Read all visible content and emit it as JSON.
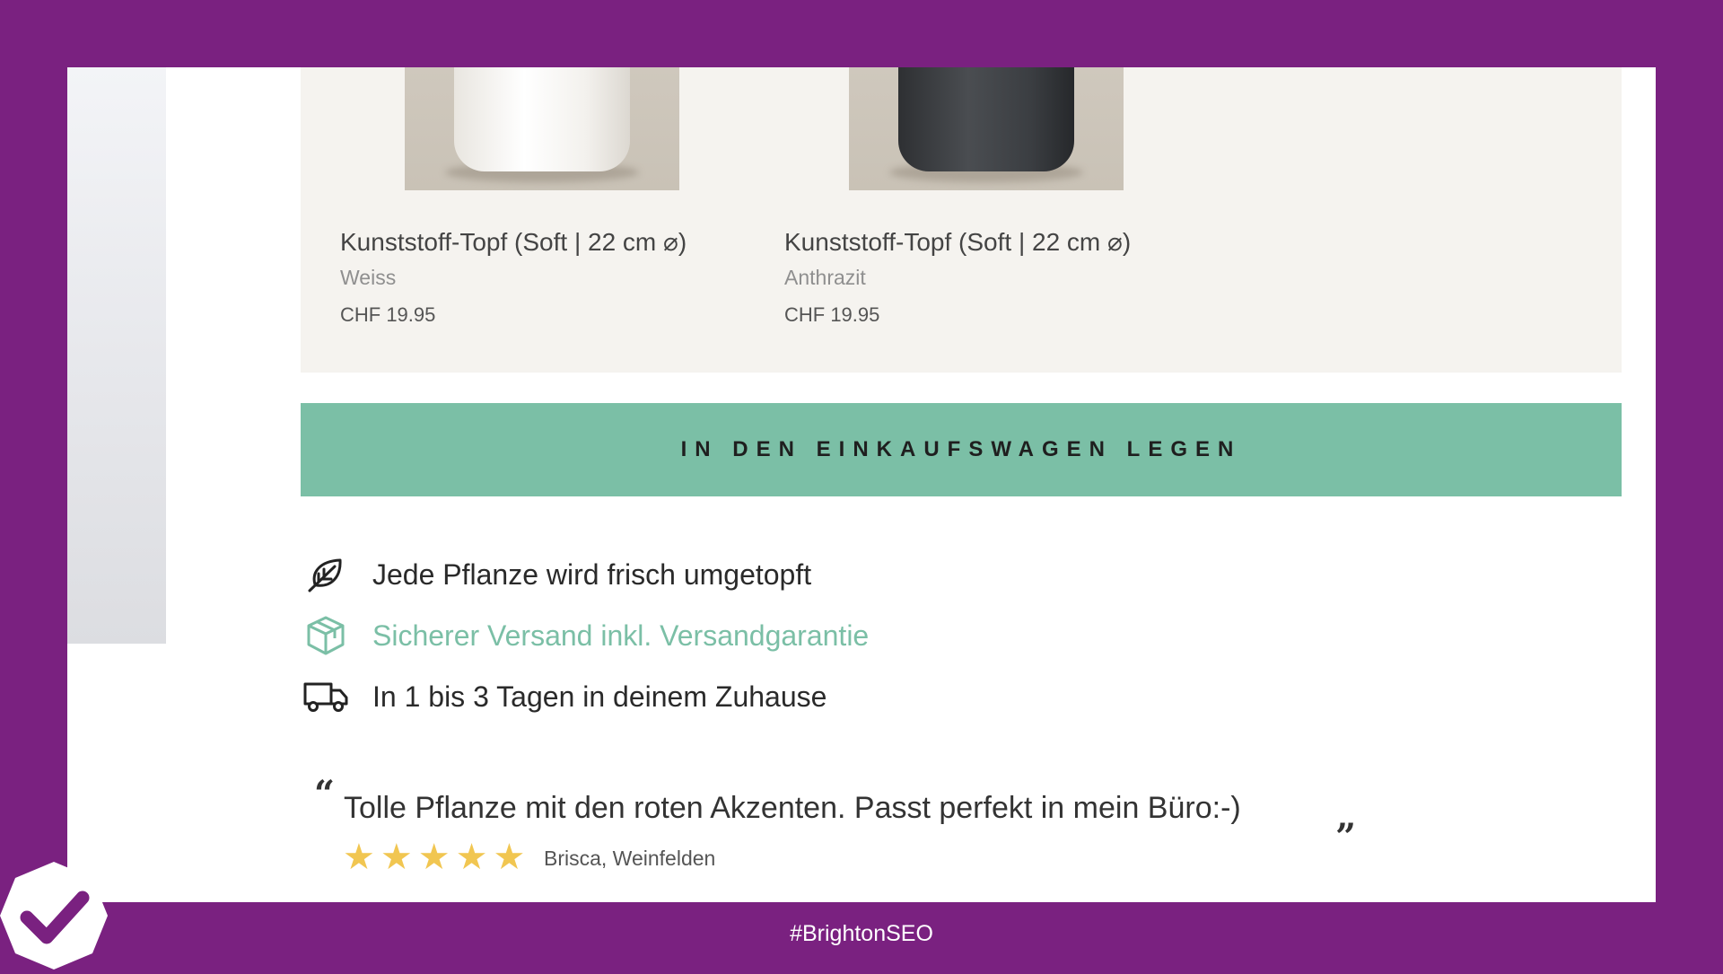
{
  "products": [
    {
      "title": "Kunststoff-Topf (Soft | 22 cm ⌀)",
      "variant": "Weiss",
      "price": "CHF 19.95"
    },
    {
      "title": "Kunststoff-Topf (Soft | 22 cm ⌀)",
      "variant": "Anthrazit",
      "price": "CHF 19.95"
    }
  ],
  "cart_button": {
    "label": "IN DEN EINKAUFSWAGEN LEGEN"
  },
  "features": [
    {
      "icon": "leaf-icon",
      "text": "Jede Pflanze wird frisch umgetopft"
    },
    {
      "icon": "box-icon",
      "text": "Sicherer Versand inkl. Versandgarantie"
    },
    {
      "icon": "truck-icon",
      "text": "In 1 bis 3 Tagen in deinem Zuhause"
    }
  ],
  "review": {
    "quote": "Tolle Pflanze mit den roten Akzenten. Passt perfekt in mein Büro:-)",
    "rating": 5,
    "reviewer": "Brisca, Weinfelden"
  },
  "footer": {
    "hashtag": "#BrightonSEO"
  },
  "colors": {
    "background": "#7a2180",
    "accent_green": "#7bbfa6",
    "star": "#f1c651",
    "panel": "#f5f3ef"
  }
}
